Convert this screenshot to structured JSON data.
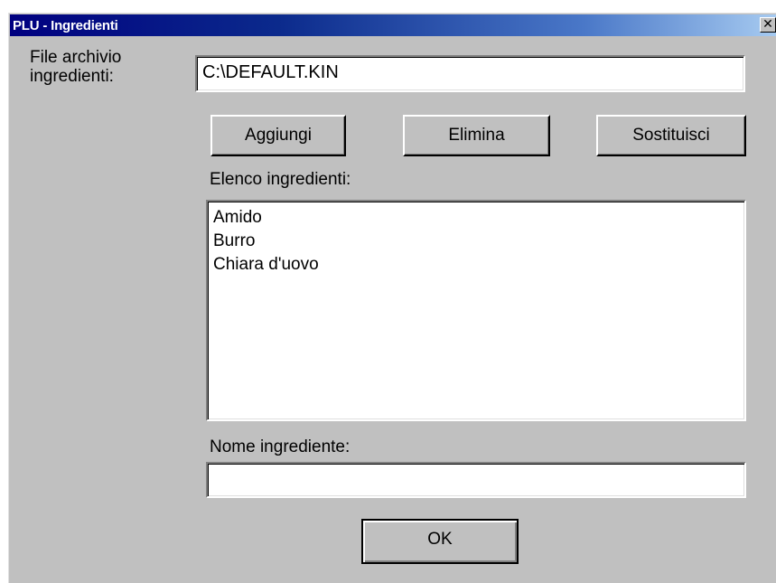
{
  "window": {
    "title": "PLU - Ingredienti",
    "close_glyph": "✕"
  },
  "file_section": {
    "label": "File archivio ingredienti:",
    "value": "C:\\DEFAULT.KIN"
  },
  "actions": {
    "add_label": "Aggiungi",
    "delete_label": "Elimina",
    "replace_label": "Sostituisci"
  },
  "ingredients": {
    "label": "Elenco ingredienti:",
    "items": [
      "Amido",
      "Burro",
      "Chiara d'uovo"
    ]
  },
  "name_field": {
    "label": "Nome ingrediente:",
    "value": ""
  },
  "footer": {
    "ok_label": "OK"
  },
  "colors": {
    "dialog_face": "#c0c0c0",
    "titlebar_start": "#000080",
    "titlebar_end": "#a6caf0",
    "field_background": "#ffffff"
  }
}
